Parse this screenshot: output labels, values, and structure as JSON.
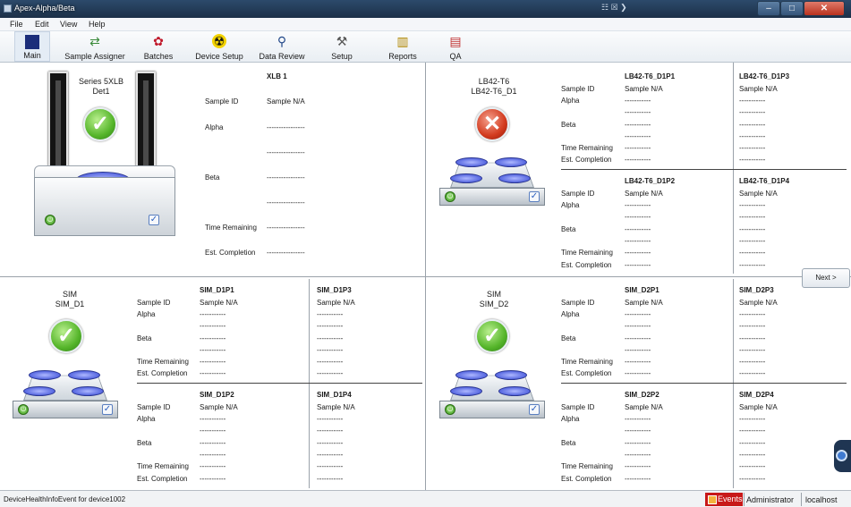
{
  "window": {
    "title": "Apex-Alpha/Beta",
    "mid_label": "☷ ☒ ❯"
  },
  "menu": [
    "File",
    "Edit",
    "View",
    "Help"
  ],
  "toolbar": [
    {
      "label": "Main",
      "icon": "main-icon",
      "glyph": "▦"
    },
    {
      "label": "Sample Assigner",
      "icon": "sample-assigner-icon",
      "glyph": "⇄"
    },
    {
      "label": "Batches",
      "icon": "batches-icon",
      "glyph": "✿"
    },
    {
      "label": "Device Setup",
      "icon": "radiation-icon",
      "glyph": "☢"
    },
    {
      "label": "Data Review",
      "icon": "binoculars-icon",
      "glyph": "⚲"
    },
    {
      "label": "Setup",
      "icon": "tools-icon",
      "glyph": "⚒"
    },
    {
      "label": "Reports",
      "icon": "books-icon",
      "glyph": "▥"
    },
    {
      "label": "QA",
      "icon": "qa-chart-icon",
      "glyph": "▤"
    }
  ],
  "fields": {
    "sample_id": "Sample ID",
    "alpha": "Alpha",
    "beta": "Beta",
    "time_remaining": "Time Remaining",
    "est_completion": "Est. Completion"
  },
  "dashes_long": "----------------",
  "dashes": "-----------",
  "sample_na": "Sample N/A",
  "xlb": {
    "name": "Series 5XLB",
    "sub": "Det1",
    "detector": "XLB 1"
  },
  "lb": {
    "name": "LB42-T6",
    "sub": "LB42-T6_D1",
    "positions": [
      "LB42-T6_D1P1",
      "LB42-T6_D1P3",
      "LB42-T6_D1P2",
      "LB42-T6_D1P4"
    ]
  },
  "sim1": {
    "name": "SIM",
    "sub": "SIM_D1",
    "positions": [
      "SIM_D1P1",
      "SIM_D1P3",
      "SIM_D1P2",
      "SIM_D1P4"
    ]
  },
  "sim2": {
    "name": "SIM",
    "sub": "SIM_D2",
    "positions": [
      "SIM_D2P1",
      "SIM_D2P3",
      "SIM_D2P2",
      "SIM_D2P4"
    ]
  },
  "next_label": "Next >",
  "status": {
    "message": "DeviceHealthInfoEvent for device1002",
    "events": "Events",
    "user": "Administrator",
    "host": "localhost"
  },
  "colors": {
    "ok": "#55b52a",
    "error": "#d23a1e",
    "events": "#c81818"
  }
}
